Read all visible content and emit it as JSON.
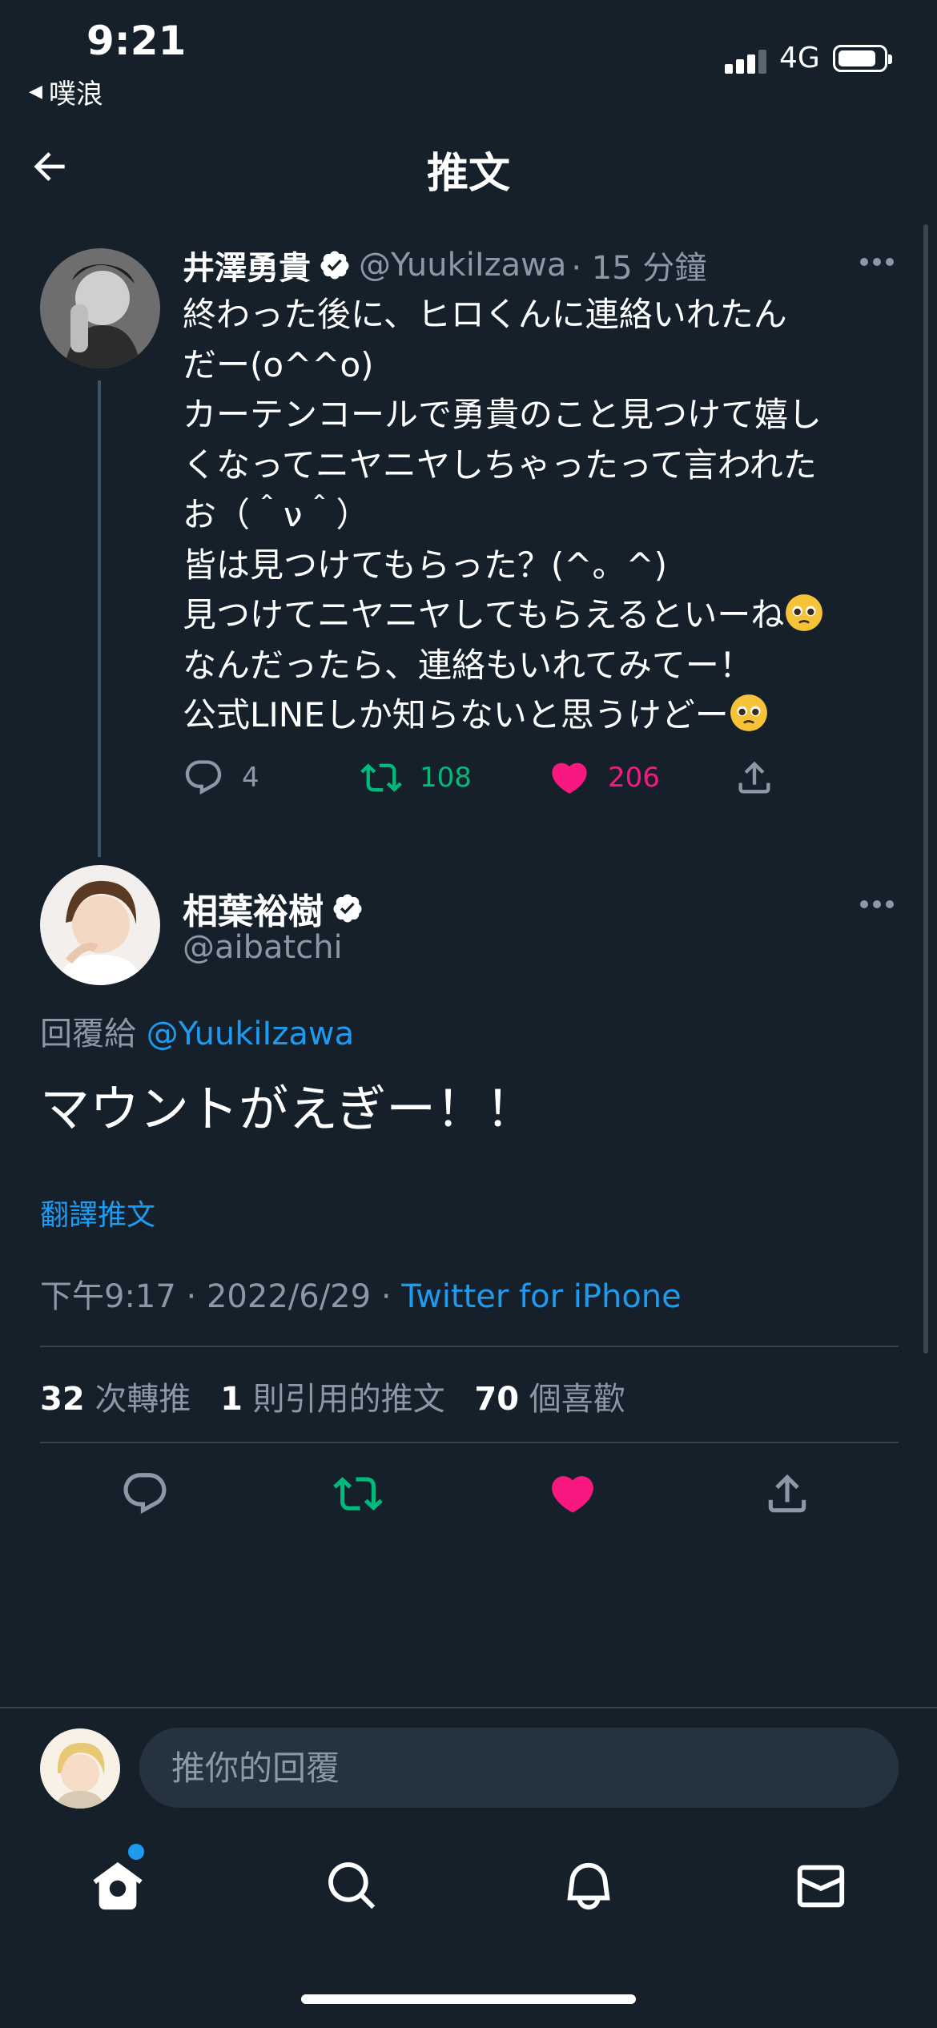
{
  "status_bar": {
    "time": "9:21",
    "back_app": "噗浪",
    "network": "4G"
  },
  "nav": {
    "title": "推文"
  },
  "tweet1": {
    "name": "井澤勇貴",
    "handle": "@YuukiIzawa",
    "time": "· 15 分鐘",
    "lines": [
      "終わった後に、ヒロくんに連絡いれたん",
      "だー(o^^o)",
      "カーテンコールで勇貴のこと見つけて嬉し",
      "くなってニヤニヤしちゃったって言われた",
      "お（＾ν＾）",
      "皆は見つけてもらった？(^。^)",
      "見つけてニヤニヤしてもらえるといーね",
      "なんだったら、連絡もいれてみてー！",
      "公式LINEしか知らないと思うけどー"
    ],
    "replies": "4",
    "retweets": "108",
    "likes": "206"
  },
  "tweet2": {
    "name": "相葉裕樹",
    "handle": "@aibatchi",
    "reply_label": "回覆給",
    "reply_handle": "@YuukiIzawa",
    "body": "マウントがえぎー！！",
    "translate": "翻譯推文",
    "time": "下午9:17",
    "date": "2022/6/29",
    "client": "Twitter for iPhone",
    "stats": {
      "retweets_count": "32",
      "retweets_label": "次轉推",
      "quotes_count": "1",
      "quotes_label": "則引用的推文",
      "likes_count": "70",
      "likes_label": "個喜歡"
    }
  },
  "reply_bar": {
    "placeholder": "推你的回覆"
  },
  "tabs": [
    "home-icon",
    "search-icon",
    "bell-icon",
    "mail-icon"
  ],
  "colors": {
    "background": "#15202b",
    "accent": "#1d9bf0",
    "retweet": "#00ba7c",
    "like": "#f91880",
    "muted": "#8b98a5"
  }
}
